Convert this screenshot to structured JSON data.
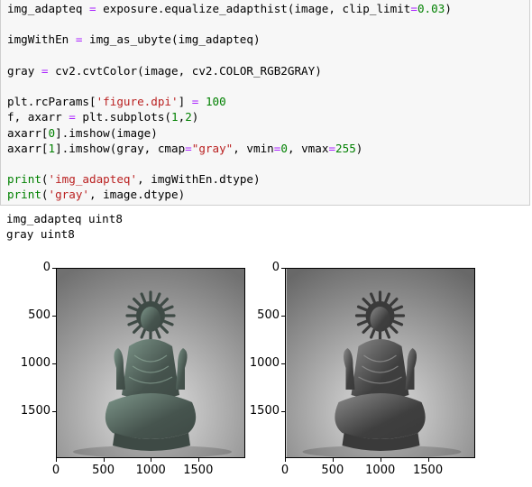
{
  "code_cell": {
    "lines": [
      [
        {
          "t": "img_adapteq "
        },
        {
          "t": "=",
          "c": "kw-eq"
        },
        {
          "t": " exposure.equalize_adapthist(image, clip_limit"
        },
        {
          "t": "=",
          "c": "kw-eq"
        },
        {
          "t": "0.03",
          "c": "kw-num"
        },
        {
          "t": ")"
        }
      ],
      [],
      [
        {
          "t": "imgWithEn "
        },
        {
          "t": "=",
          "c": "kw-eq"
        },
        {
          "t": " img_as_ubyte(img_adapteq)"
        }
      ],
      [],
      [
        {
          "t": "gray "
        },
        {
          "t": "=",
          "c": "kw-eq"
        },
        {
          "t": " cv2.cvtColor(image, cv2.COLOR_RGB2GRAY)"
        }
      ],
      [],
      [
        {
          "t": "plt.rcParams["
        },
        {
          "t": "'figure.dpi'",
          "c": "kw-str"
        },
        {
          "t": "] "
        },
        {
          "t": "=",
          "c": "kw-eq"
        },
        {
          "t": " "
        },
        {
          "t": "100",
          "c": "kw-num"
        }
      ],
      [
        {
          "t": "f, axarr "
        },
        {
          "t": "=",
          "c": "kw-eq"
        },
        {
          "t": " plt.subplots("
        },
        {
          "t": "1",
          "c": "kw-num"
        },
        {
          "t": ","
        },
        {
          "t": "2",
          "c": "kw-num"
        },
        {
          "t": ")"
        }
      ],
      [
        {
          "t": "axarr["
        },
        {
          "t": "0",
          "c": "kw-num"
        },
        {
          "t": "].imshow(image)"
        }
      ],
      [
        {
          "t": "axarr["
        },
        {
          "t": "1",
          "c": "kw-num"
        },
        {
          "t": "].imshow(gray, cmap"
        },
        {
          "t": "=",
          "c": "kw-eq"
        },
        {
          "t": "\"gray\"",
          "c": "kw-str"
        },
        {
          "t": ", vmin"
        },
        {
          "t": "=",
          "c": "kw-eq"
        },
        {
          "t": "0",
          "c": "kw-num"
        },
        {
          "t": ", vmax"
        },
        {
          "t": "=",
          "c": "kw-eq"
        },
        {
          "t": "255",
          "c": "kw-num"
        },
        {
          "t": ")"
        }
      ],
      [],
      [
        {
          "t": "print",
          "c": "kw-builtin"
        },
        {
          "t": "("
        },
        {
          "t": "'img_adapteq'",
          "c": "kw-str"
        },
        {
          "t": ", imgWithEn.dtype)"
        }
      ],
      [
        {
          "t": "print",
          "c": "kw-builtin"
        },
        {
          "t": "("
        },
        {
          "t": "'gray'",
          "c": "kw-str"
        },
        {
          "t": ", image.dtype)"
        }
      ]
    ]
  },
  "output": {
    "lines": [
      "img_adapteq uint8",
      "gray uint8"
    ]
  },
  "plots": [
    {
      "name": "color-image",
      "y_ticks": [
        "0",
        "500",
        "1000",
        "1500"
      ],
      "x_ticks": [
        "0",
        "500",
        "1000",
        "1500"
      ],
      "tint": "#5a7a70"
    },
    {
      "name": "gray-image",
      "y_ticks": [
        "0",
        "500",
        "1000",
        "1500"
      ],
      "x_ticks": [
        "0",
        "500",
        "1000",
        "1500"
      ],
      "tint": "#4a4a4a"
    }
  ]
}
